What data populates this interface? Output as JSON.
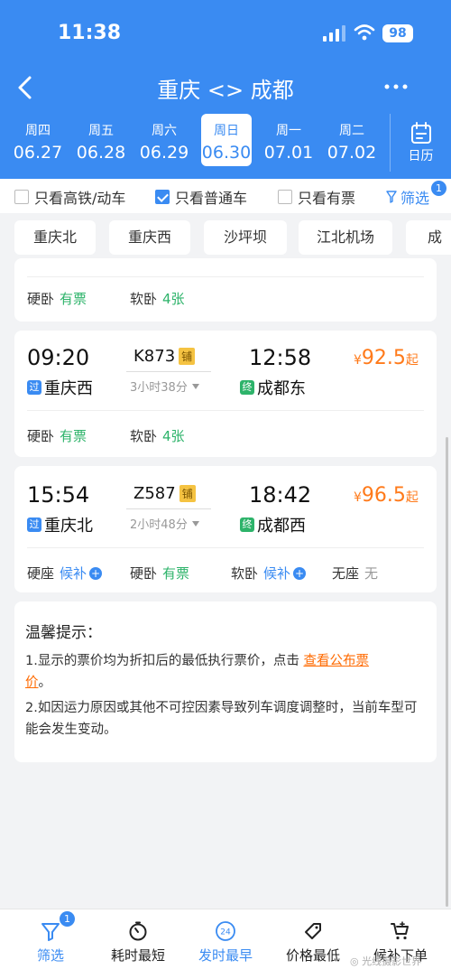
{
  "status": {
    "time": "11:38",
    "battery": "98"
  },
  "nav": {
    "title": "重庆 <> 成都"
  },
  "dates": [
    {
      "dow": "周四",
      "md": "06.27"
    },
    {
      "dow": "周五",
      "md": "06.28"
    },
    {
      "dow": "周六",
      "md": "06.29"
    },
    {
      "dow": "周日",
      "md": "06.30"
    },
    {
      "dow": "周一",
      "md": "07.01"
    },
    {
      "dow": "周二",
      "md": "07.02"
    }
  ],
  "calendar_label": "日历",
  "filters": {
    "high_speed": "只看高铁/动车",
    "normal": "只看普通车",
    "available": "只看有票",
    "screen": "筛选",
    "screen_badge": "1"
  },
  "stations": [
    "重庆北",
    "重庆西",
    "沙坪坝",
    "江北机场",
    "成"
  ],
  "partial_card": {
    "seats": [
      {
        "type": "硬卧",
        "status": "有票"
      },
      {
        "type": "软卧",
        "status": "4张"
      }
    ]
  },
  "trains": [
    {
      "dep_time": "09:20",
      "train_no": "K873",
      "tag": "铺",
      "arr_time": "12:58",
      "duration": "3小时38分",
      "dep_mark": "过",
      "dep_station": "重庆西",
      "arr_mark": "终",
      "arr_station": "成都东",
      "price_currency": "¥",
      "price": "92.5",
      "price_suffix": "起",
      "seats": [
        {
          "type": "硬卧",
          "status": "有票"
        },
        {
          "type": "软卧",
          "status": "4张"
        }
      ]
    },
    {
      "dep_time": "15:54",
      "train_no": "Z587",
      "tag": "铺",
      "arr_time": "18:42",
      "duration": "2小时48分",
      "dep_mark": "过",
      "dep_station": "重庆北",
      "arr_mark": "终",
      "arr_station": "成都西",
      "price_currency": "¥",
      "price": "96.5",
      "price_suffix": "起",
      "seats": [
        {
          "type": "硬座",
          "status": "候补"
        },
        {
          "type": "硬卧",
          "status": "有票"
        },
        {
          "type": "软卧",
          "status": "候补"
        },
        {
          "type": "无座",
          "status": "无"
        }
      ]
    }
  ],
  "tips": {
    "heading": "温馨提示：",
    "line1_a": "1.显示的票价均为折扣后的最低执行票价，点击 ",
    "line1_link_a": "查看公布票",
    "line1_link_b": "价",
    "line1_end": "。",
    "line2": "2.如因运力原因或其他不可控因素导致列车调度调整时，当前车型可能会发生变动。"
  },
  "bottom_tabs": [
    {
      "label": "筛选",
      "badge": "1"
    },
    {
      "label": "耗时最短"
    },
    {
      "label": "发时最早",
      "icon_text": "24"
    },
    {
      "label": "价格最低"
    },
    {
      "label": "候补下单"
    }
  ],
  "watermark": "光线摄影世界"
}
